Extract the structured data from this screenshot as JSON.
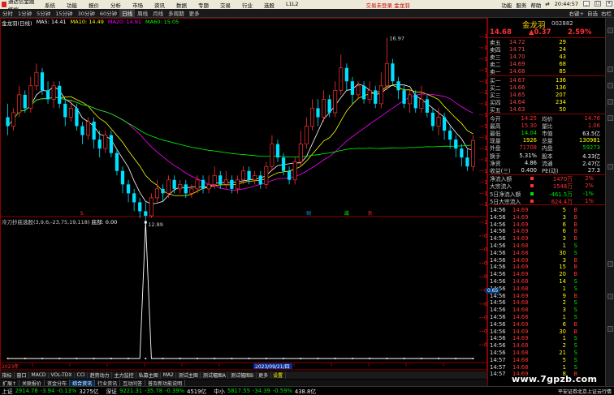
{
  "app": {
    "logo_text": "通达信金融终端",
    "menu": [
      "系统",
      "功能",
      "报价",
      "分析",
      "市场",
      "资讯",
      "数据",
      "专题",
      "交易",
      "行业",
      "选股",
      "L1L2"
    ],
    "center_text": "交易未登录  金龙羽",
    "right_menu": [
      "功能",
      "服务",
      "帮助",
      "⇄"
    ]
  },
  "toolbar": {
    "items": [
      "分时",
      "1分钟",
      "5分钟",
      "15分钟",
      "30分钟",
      "60分钟",
      "日线",
      "周线",
      "月线",
      "多周期",
      "更多"
    ],
    "active_index": 6,
    "right_items": [
      "右键+",
      "自选",
      "右栏"
    ]
  },
  "chart_title": "金龙羽(日线)",
  "ma_legend": [
    {
      "label": "MA5: 14.41",
      "color": "#ffffff"
    },
    {
      "label": "MA10: 14.49",
      "color": "#ffff00"
    },
    {
      "label": "MA20: 14.91",
      "color": "#ff00ff"
    },
    {
      "label": "MA60: 15.05",
      "color": "#00ff00"
    }
  ],
  "chart_data": {
    "type": "candlestick",
    "y_ticks": [
      17.0,
      16.75,
      16.5,
      16.25,
      16.0,
      15.75,
      15.5,
      15.25,
      15.0,
      14.75,
      14.5,
      14.25,
      14.0,
      13.75,
      13.5,
      13.25
    ],
    "ylim": [
      13.0,
      17.2
    ],
    "high_label": "16.97",
    "low_label": "12.89",
    "x_labels": [
      "2023年",
      "2023/09/21/四"
    ],
    "up_color": "#ff3030",
    "down_color": "#00e0ff",
    "candles": [
      [
        15.2,
        15.0,
        15.5,
        14.8
      ],
      [
        15.0,
        15.3,
        15.4,
        14.9
      ],
      [
        15.3,
        15.7,
        15.9,
        15.2
      ],
      [
        15.7,
        15.4,
        15.8,
        15.3
      ],
      [
        15.4,
        15.9,
        16.1,
        15.3
      ],
      [
        15.9,
        16.2,
        16.4,
        15.8
      ],
      [
        16.2,
        15.8,
        16.3,
        15.7
      ],
      [
        15.8,
        15.6,
        16.0,
        15.5
      ],
      [
        15.6,
        15.9,
        16.0,
        15.4
      ],
      [
        15.9,
        15.5,
        16.0,
        15.4
      ],
      [
        15.5,
        15.2,
        15.6,
        15.0
      ],
      [
        15.2,
        15.4,
        15.6,
        15.1
      ],
      [
        15.4,
        15.0,
        15.5,
        14.9
      ],
      [
        15.0,
        14.8,
        15.1,
        14.6
      ],
      [
        14.8,
        15.1,
        15.2,
        14.7
      ],
      [
        15.1,
        14.7,
        15.2,
        14.5
      ],
      [
        14.7,
        14.5,
        14.9,
        14.3
      ],
      [
        14.5,
        14.8,
        14.9,
        14.4
      ],
      [
        14.8,
        14.4,
        14.9,
        14.3
      ],
      [
        14.4,
        14.0,
        14.5,
        13.9
      ],
      [
        14.0,
        13.7,
        14.1,
        13.5
      ],
      [
        13.7,
        13.5,
        13.8,
        13.3
      ],
      [
        13.5,
        13.3,
        13.6,
        13.1
      ],
      [
        13.3,
        13.1,
        13.4,
        12.95
      ],
      [
        13.1,
        13.0,
        13.3,
        12.89
      ],
      [
        13.0,
        13.4,
        13.5,
        12.95
      ],
      [
        13.4,
        13.6,
        13.8,
        13.3
      ],
      [
        13.6,
        13.5,
        13.7,
        13.3
      ],
      [
        13.5,
        13.8,
        13.9,
        13.4
      ],
      [
        13.8,
        13.6,
        13.9,
        13.5
      ],
      [
        13.6,
        13.7,
        13.8,
        13.5
      ],
      [
        13.7,
        13.5,
        13.8,
        13.4
      ],
      [
        13.5,
        13.6,
        13.7,
        13.4
      ],
      [
        13.6,
        13.8,
        13.9,
        13.5
      ],
      [
        13.8,
        13.6,
        13.9,
        13.5
      ],
      [
        13.6,
        13.7,
        13.9,
        13.5
      ],
      [
        13.7,
        13.9,
        14.1,
        13.6
      ],
      [
        13.9,
        13.7,
        14.0,
        13.6
      ],
      [
        13.7,
        13.8,
        14.0,
        13.6
      ],
      [
        13.8,
        13.6,
        13.9,
        13.5
      ],
      [
        13.6,
        13.8,
        13.9,
        13.5
      ],
      [
        13.8,
        14.0,
        14.1,
        13.7
      ],
      [
        14.0,
        13.8,
        14.1,
        13.7
      ],
      [
        13.8,
        13.9,
        14.0,
        13.7
      ],
      [
        13.9,
        13.7,
        14.0,
        13.6
      ],
      [
        13.7,
        14.1,
        14.2,
        13.6
      ],
      [
        14.1,
        14.6,
        14.8,
        14.0
      ],
      [
        14.6,
        14.3,
        14.7,
        14.2
      ],
      [
        14.3,
        14.0,
        14.4,
        13.9
      ],
      [
        14.0,
        13.8,
        14.1,
        13.7
      ],
      [
        13.8,
        14.2,
        14.3,
        13.7
      ],
      [
        14.2,
        14.6,
        14.9,
        14.1
      ],
      [
        14.6,
        15.0,
        15.2,
        14.5
      ],
      [
        15.0,
        15.4,
        15.6,
        14.9
      ],
      [
        15.4,
        15.2,
        15.6,
        15.0
      ],
      [
        15.2,
        15.6,
        15.8,
        15.1
      ],
      [
        15.6,
        15.3,
        15.7,
        15.2
      ],
      [
        15.3,
        15.8,
        16.0,
        15.2
      ],
      [
        15.8,
        16.3,
        16.6,
        15.7
      ],
      [
        16.3,
        16.0,
        16.4,
        15.8
      ],
      [
        16.0,
        15.7,
        16.1,
        15.5
      ],
      [
        15.7,
        15.9,
        16.0,
        15.6
      ],
      [
        15.9,
        15.6,
        16.0,
        15.5
      ],
      [
        15.6,
        15.8,
        16.0,
        15.5
      ],
      [
        15.8,
        15.5,
        15.9,
        15.4
      ],
      [
        15.5,
        15.9,
        16.2,
        15.4
      ],
      [
        15.9,
        16.4,
        16.97,
        15.8
      ],
      [
        16.4,
        16.0,
        16.5,
        15.9
      ],
      [
        16.0,
        15.8,
        16.1,
        15.6
      ],
      [
        15.8,
        15.5,
        15.9,
        15.4
      ],
      [
        15.5,
        15.7,
        15.8,
        15.3
      ],
      [
        15.7,
        15.4,
        15.8,
        15.3
      ],
      [
        15.4,
        15.6,
        15.9,
        15.3
      ],
      [
        15.6,
        15.3,
        15.7,
        15.2
      ],
      [
        15.3,
        15.0,
        15.4,
        14.9
      ],
      [
        15.0,
        15.2,
        15.4,
        14.8
      ],
      [
        15.2,
        14.9,
        15.3,
        14.7
      ],
      [
        14.9,
        14.7,
        15.0,
        14.5
      ],
      [
        14.7,
        14.5,
        14.8,
        14.3
      ],
      [
        14.5,
        14.3,
        14.6,
        14.1
      ],
      [
        14.3,
        14.1,
        14.5,
        14.0
      ],
      [
        14.1,
        14.68,
        14.8,
        14.0
      ]
    ]
  },
  "markers": [
    {
      "text": "S",
      "color": "#ff3030",
      "pos": 0.16
    },
    {
      "text": "财",
      "color": "#00a8ff",
      "pos": 0.64
    },
    {
      "text": "减",
      "color": "#00ff00",
      "pos": 0.72
    },
    {
      "text": "东",
      "color": "#ff3030",
      "pos": 0.77
    }
  ],
  "indicator": {
    "legend_name": "冷刀抄底选股(3,9,6,-23,75,19,118)",
    "legend_value_label": "底部: 0.00",
    "y_ticks": [
      "1.00",
      "0.90",
      "0.80",
      "0.70",
      "0.60",
      "0.50",
      "0.40",
      "0.30",
      "0.20",
      "0.10"
    ],
    "highlight_value": "0.65",
    "values": [
      0,
      0,
      0,
      0,
      0,
      0,
      0,
      0,
      0,
      0,
      0,
      0,
      0,
      0,
      0,
      0,
      0,
      0,
      0,
      0,
      0,
      0,
      0,
      0,
      1,
      0,
      0,
      0,
      0,
      0,
      0,
      0,
      0,
      0,
      0,
      0,
      0,
      0,
      0,
      0,
      0,
      0,
      0,
      0,
      0,
      0,
      0,
      0,
      0,
      0,
      0,
      0,
      0,
      0,
      0,
      0,
      0,
      0,
      0,
      0,
      0,
      0,
      0,
      0,
      0,
      0,
      0,
      0,
      0,
      0,
      0,
      0,
      0,
      0,
      0,
      0,
      0,
      0,
      0,
      0,
      0,
      0
    ]
  },
  "funcbar": [
    "指标",
    "窗口",
    "MACD",
    "VOL-TDX",
    "CCI",
    "趋势动力",
    "主力监控",
    "私募主图",
    "MA2",
    "测试主图",
    "测试幅图A",
    "测试幅图B",
    "更多",
    "设置"
  ],
  "bottom_tabs": [
    "扩展↑",
    "关联报价",
    "资金分布",
    "综合资讯",
    "行业资讯",
    "互动问答",
    "普及新功能说明"
  ],
  "stock": {
    "name": "金龙羽",
    "code": "002882",
    "price": "14.68",
    "change": "▲0.37",
    "pct": "2.59%"
  },
  "orderbook": {
    "sells": [
      {
        "label": "卖五",
        "price": "14.72",
        "vol": "29"
      },
      {
        "label": "卖四",
        "price": "14.71",
        "vol": "24"
      },
      {
        "label": "卖三",
        "price": "14.70",
        "vol": "43"
      },
      {
        "label": "卖二",
        "price": "14.69",
        "vol": "68"
      },
      {
        "label": "卖一",
        "price": "14.68",
        "vol": "85"
      }
    ],
    "buys": [
      {
        "label": "买一",
        "price": "14.67",
        "vol": "136"
      },
      {
        "label": "买二",
        "price": "14.66",
        "vol": "136"
      },
      {
        "label": "买三",
        "price": "14.65",
        "vol": "207"
      },
      {
        "label": "买四",
        "price": "14.64",
        "vol": "234"
      },
      {
        "label": "买五",
        "price": "14.63",
        "vol": "50"
      }
    ]
  },
  "quote_info": [
    {
      "l1": "今开",
      "v1": "14.25",
      "v1c": "#ff3030",
      "l2": "均价",
      "v2": "14.76",
      "v2c": "#ff3030"
    },
    {
      "l1": "最高",
      "v1": "15.30",
      "v1c": "#ff3030",
      "l2": "量比",
      "v2": "1.06",
      "v2c": "#ff3030"
    },
    {
      "l1": "最低",
      "v1": "14.04",
      "v1c": "#00e000",
      "l2": "市值",
      "v2": "63.5亿",
      "v2c": "#eeeeee"
    },
    {
      "l1": "现量",
      "v1": "1926",
      "v1c": "#ffff00",
      "l2": "总量",
      "v2": "130981",
      "v2c": "#ffff00"
    },
    {
      "l1": "外盘",
      "v1": "71708",
      "v1c": "#ff3030",
      "l2": "内盘",
      "v2": "59273",
      "v2c": "#00e000"
    },
    {
      "l1": "换手",
      "v1": "5.31%",
      "v1c": "#eeeeee",
      "l2": "股本",
      "v2": "4.33亿",
      "v2c": "#eeeeee"
    },
    {
      "l1": "净资",
      "v1": "4.86",
      "v1c": "#eeeeee",
      "l2": "流通",
      "v2": "2.47亿",
      "v2c": "#eeeeee"
    },
    {
      "l1": "收益(三)",
      "v1": "0.400",
      "v1c": "#eeeeee",
      "l2": "PE(动)",
      "v2": "27.3",
      "v2c": "#eeeeee"
    }
  ],
  "capital_flow": [
    {
      "label": "净流入额",
      "value": "1470万",
      "pct": "2%",
      "color": "#ff3030"
    },
    {
      "label": "大宗流入",
      "value": "1548万",
      "pct": "2%",
      "color": "#ff3030"
    },
    {
      "label": "5日净流入额",
      "value": "-461.5万",
      "pct": "-1%",
      "color": "#00e000"
    },
    {
      "label": "5日大宗流入",
      "value": "624.4万",
      "pct": "1%",
      "color": "#ff3030"
    }
  ],
  "trades": [
    {
      "t": "14:56",
      "p": "14.69",
      "v": "5",
      "d": "B"
    },
    {
      "t": "14:56",
      "p": "14.69",
      "v": "3",
      "d": "B"
    },
    {
      "t": "14:56",
      "p": "14.69",
      "v": "6",
      "d": "B"
    },
    {
      "t": "14:56",
      "p": "14.69",
      "v": "6",
      "d": "B"
    },
    {
      "t": "14:56",
      "p": "14.69",
      "v": "3",
      "d": "B"
    },
    {
      "t": "14:56",
      "p": "14.68",
      "v": "1",
      "d": "S"
    },
    {
      "t": "14:56",
      "p": "14.68",
      "v": "30",
      "d": "S"
    },
    {
      "t": "14:56",
      "p": "14.69",
      "v": "3",
      "d": "B"
    },
    {
      "t": "14:56",
      "p": "14.69",
      "v": "15",
      "d": "B"
    },
    {
      "t": "14:56",
      "p": "14.69",
      "v": "20",
      "d": "B"
    },
    {
      "t": "14:56",
      "p": "14.68",
      "v": "14",
      "d": "S"
    },
    {
      "t": "14:56",
      "p": "14.68",
      "v": "1",
      "d": "S"
    },
    {
      "t": "14:56",
      "p": "14.69",
      "v": "9",
      "d": "B"
    },
    {
      "t": "14:56",
      "p": "14.68",
      "v": "2",
      "d": "S"
    },
    {
      "t": "14:56",
      "p": "14.68",
      "v": "3",
      "d": "S"
    },
    {
      "t": "14:56",
      "p": "14.68",
      "v": "1",
      "d": "S"
    },
    {
      "t": "14:56",
      "p": "14.69",
      "v": "6",
      "d": "B"
    },
    {
      "t": "14:56",
      "p": "14.69",
      "v": "30",
      "d": "B"
    },
    {
      "t": "14:56",
      "p": "14.69",
      "v": "1",
      "d": "S"
    },
    {
      "t": "14:56",
      "p": "14.68",
      "v": "2",
      "d": "S"
    },
    {
      "t": "14:56",
      "p": "14.68",
      "v": "21",
      "d": "S"
    },
    {
      "t": "14:57",
      "p": "14.68",
      "v": "5",
      "d": "S"
    },
    {
      "t": "14:57",
      "p": "14.68",
      "v": "1",
      "d": "S"
    },
    {
      "t": "14:57",
      "p": "14.69",
      "v": "8",
      "d": "B"
    }
  ],
  "statusbar": [
    {
      "name": "上证",
      "v": "2914.78",
      "c": "-3.94",
      "p": "-0.13%",
      "amt": "3275亿"
    },
    {
      "name": "深证",
      "v": "9221.31",
      "c": "-35.78",
      "p": "-0.39%",
      "amt": "4519亿"
    },
    {
      "name": "中小",
      "v": "5817.55",
      "c": "-34.39",
      "p": "-0.59%",
      "amt": "438.8亿"
    }
  ],
  "status_right": "平安证券北京上证云行情",
  "watermark": "www.7gpzb.com",
  "time": "20:44:57"
}
